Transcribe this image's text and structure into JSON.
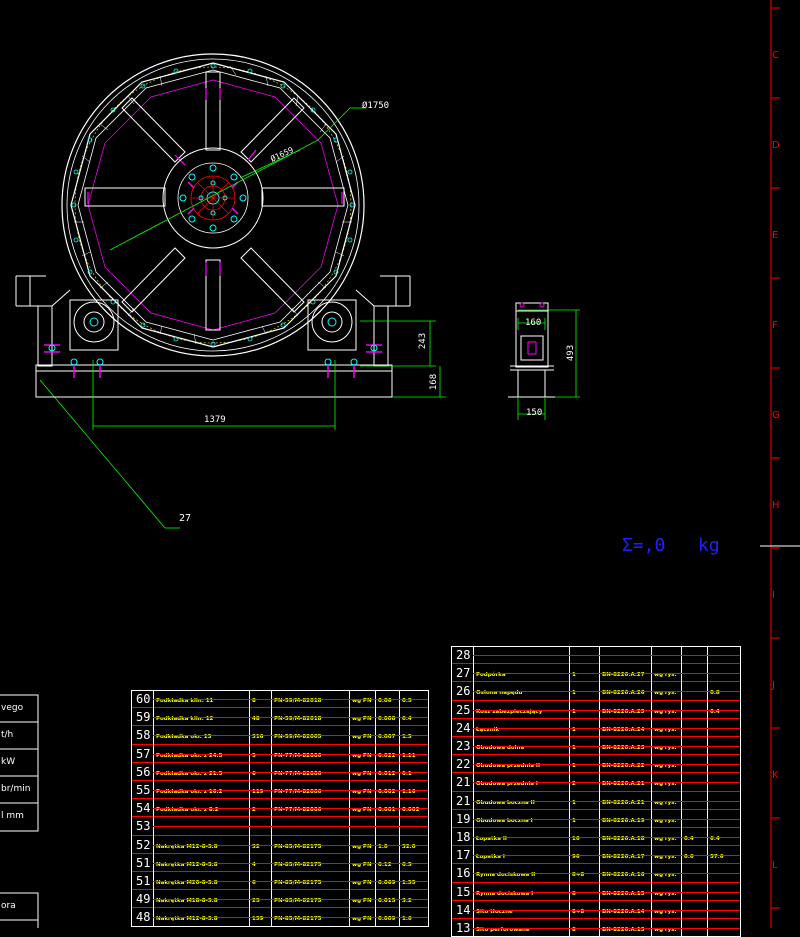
{
  "drawing": {
    "dims": {
      "outer_dia": "Ø1750",
      "inner_dia": "Ø1659",
      "h1": "243",
      "h2": "168",
      "span": "1379",
      "box_w": "160",
      "box_h": "493",
      "box_base": "150",
      "callout": "27"
    },
    "mass_total": "Σ=,0   kg"
  },
  "border": {
    "zones": [
      "C",
      "D",
      "E",
      "F",
      "G",
      "H",
      "I",
      "J",
      "K",
      "L"
    ]
  },
  "side_table": {
    "rows": [
      "vego",
      "t/h",
      "kW",
      "br/min",
      "l mm"
    ],
    "row2": [
      "ora"
    ]
  },
  "bom_left": {
    "rows": [
      {
        "no": "60",
        "name": "Podkładka klin. 11",
        "qty": "8",
        "norm": "PN-59/M-82018",
        "mat": "wg PN",
        "m1": "0.06",
        "m2": "0.5"
      },
      {
        "no": "59",
        "name": "Podkładka klin. 12",
        "qty": "48",
        "norm": "PN-59/M-82018",
        "mat": "wg PN",
        "m1": "0.008",
        "m2": "0.4"
      },
      {
        "no": "58",
        "name": "Podkładka okr. 13",
        "qty": "316",
        "norm": "PN-59/M-82005",
        "mat": "wg PN",
        "m1": "0.007",
        "m2": "1.5"
      },
      {
        "no": "57",
        "name": "Podkładka okr. z 24.5",
        "qty": "5",
        "norm": "PN-77/M-82006",
        "mat": "wg PN",
        "m1": "0.022",
        "m2": "1.11"
      },
      {
        "no": "56",
        "name": "Podkładka okr. z 21.5",
        "qty": "6",
        "norm": "PN-77/M-82006",
        "mat": "wg PN",
        "m1": "0.012",
        "m2": "0.1"
      },
      {
        "no": "55",
        "name": "Podkładka okr. z 16.2",
        "qty": "119",
        "norm": "PN-77/M-82006",
        "mat": "wg PN",
        "m1": "0.002",
        "m2": "1.16"
      },
      {
        "no": "54",
        "name": "Podkładka okr. z 8.2",
        "qty": "2",
        "norm": "PN-77/M-82006",
        "mat": "wg PN",
        "m1": "0.001",
        "m2": "0.002"
      },
      {
        "no": "53",
        "name": "",
        "qty": "",
        "norm": "",
        "mat": "",
        "m1": "",
        "m2": ""
      },
      {
        "no": "52",
        "name": "Nakrętka M12-8-5.8",
        "qty": "32",
        "norm": "PN-85/M-82175",
        "mat": "wg PN",
        "m1": "1.0",
        "m2": "32.0"
      },
      {
        "no": "51",
        "name": "Nakrętka M12-8-5.8",
        "qty": "4",
        "norm": "PN-85/M-82175",
        "mat": "wg PN",
        "m1": "0.12",
        "m2": "0.5"
      },
      {
        "no": "51",
        "name": "Nakrętka M20-8-5.8",
        "qty": "6",
        "norm": "PN-85/M-82175",
        "mat": "wg PN",
        "m1": "0.069",
        "m2": "1.55"
      },
      {
        "no": "49",
        "name": "Nakrętka M18-8-5.8",
        "qty": "25",
        "norm": "PN-85/M-82175",
        "mat": "wg PN",
        "m1": "0.015",
        "m2": "3.2"
      },
      {
        "no": "48",
        "name": "Nakrętka M12-8-5.8",
        "qty": "159",
        "norm": "PN-85/M-82175",
        "mat": "wg PN",
        "m1": "0.009",
        "m2": "1.6"
      }
    ]
  },
  "bom_right": {
    "rows": [
      {
        "no": "28",
        "name": "",
        "qty": "",
        "norm": "",
        "mat": "",
        "m1": "",
        "m2": ""
      },
      {
        "no": "27",
        "name": "Podpórka",
        "qty": "1",
        "norm": "BN-8226.A.27",
        "mat": "wg rys.",
        "m1": "",
        "m2": ""
      },
      {
        "no": "26",
        "name": "Osłona napędu",
        "qty": "1",
        "norm": "BN-8226.A.26",
        "mat": "wg rys.",
        "m1": "",
        "m2": "0.8"
      },
      {
        "no": "25",
        "name": "Kosz zabezpieczający",
        "qty": "1",
        "norm": "BN-8226.A.25",
        "mat": "wg rys.",
        "m1": "",
        "m2": "0.4"
      },
      {
        "no": "24",
        "name": "Łącznik",
        "qty": "1",
        "norm": "BN-8226.A.24",
        "mat": "wg rys.",
        "m1": "",
        "m2": ""
      },
      {
        "no": "23",
        "name": "Obudowa dolna",
        "qty": "1",
        "norm": "BN-8226.A.23",
        "mat": "wg rys.",
        "m1": "",
        "m2": ""
      },
      {
        "no": "22",
        "name": "Obudowa przednia II",
        "qty": "1",
        "norm": "BN-8226.A.22",
        "mat": "wg rys.",
        "m1": "",
        "m2": ""
      },
      {
        "no": "21",
        "name": "Obudowa przednia I",
        "qty": "2",
        "norm": "BN-8226.A.21",
        "mat": "wg rys.",
        "m1": "",
        "m2": ""
      },
      {
        "no": "21",
        "name": "Obudowa boczna II",
        "qty": "1",
        "norm": "BN-8226.A.21",
        "mat": "wg rys.",
        "m1": "",
        "m2": ""
      },
      {
        "no": "19",
        "name": "Obudowa boczna I",
        "qty": "1",
        "norm": "BN-8226.A.19",
        "mat": "wg rys.",
        "m1": "",
        "m2": ""
      },
      {
        "no": "18",
        "name": "Łopatka II",
        "qty": "16",
        "norm": "BN-8226.A.18",
        "mat": "wg rys.",
        "m1": "0.4",
        "m2": "6.4"
      },
      {
        "no": "17",
        "name": "Łopatka I",
        "qty": "96",
        "norm": "BN-8226.A.17",
        "mat": "wg rys.",
        "m1": "0.6",
        "m2": "57.6"
      },
      {
        "no": "16",
        "name": "Rynna dociskowa II",
        "qty": "8+8",
        "norm": "BN-8226.A.16",
        "mat": "wg rys.",
        "m1": "",
        "m2": ""
      },
      {
        "no": "15",
        "name": "Rynna dociskowa I",
        "qty": "8",
        "norm": "BN-8226.A.15",
        "mat": "wg rys.",
        "m1": "",
        "m2": ""
      },
      {
        "no": "14",
        "name": "Sito tłoczne",
        "qty": "8+8",
        "norm": "BN-8226.A.14",
        "mat": "wg rys.",
        "m1": "",
        "m2": ""
      },
      {
        "no": "13",
        "name": "Sito perforowane",
        "qty": "8",
        "norm": "BN-8226.A.13",
        "mat": "wg rys.",
        "m1": "",
        "m2": ""
      }
    ]
  },
  "colors": {
    "bg": "#000000",
    "white": "#ffffff",
    "green": "#00ff00",
    "cyan": "#00ffff",
    "magenta": "#ff00ff",
    "red": "#ff0000",
    "yellow": "#ffff00",
    "blue": "#2020ff"
  }
}
